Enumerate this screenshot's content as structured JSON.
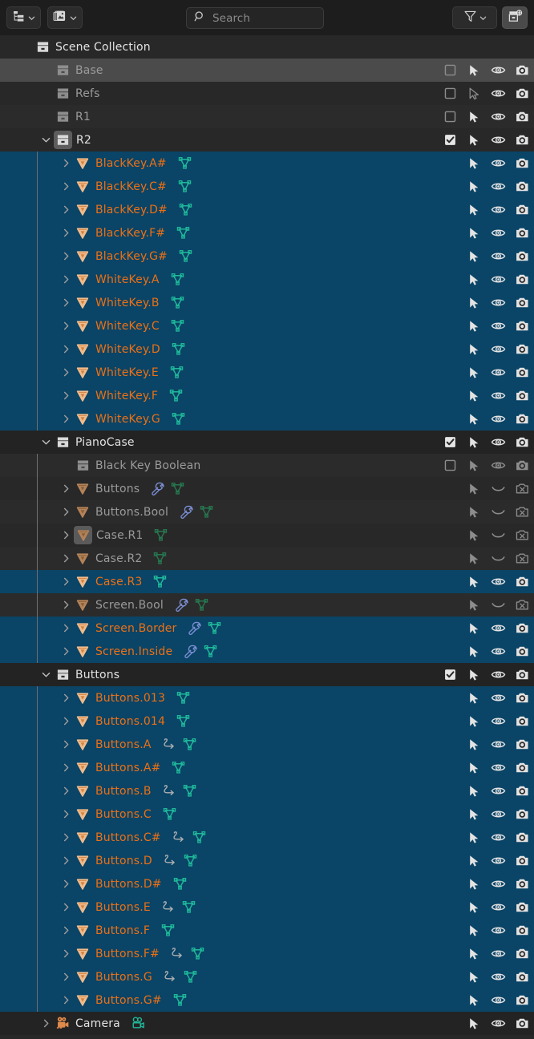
{
  "header": {
    "display_mode_button": "outliner-display-mode",
    "display_mode_icon": "tree-list-icon",
    "filter_id_button": "blend-file-id-icon",
    "search": {
      "placeholder": "Search",
      "value": "",
      "icon": "search-icon"
    },
    "filter": {
      "icon": "filter-funnel-icon",
      "label": ""
    },
    "new_collection": {
      "icon": "new-collection-icon",
      "label": ""
    }
  },
  "colors": {
    "selected_row_bg": "#0a4466",
    "active_row_bg": "#4b4b4b",
    "row_bg_a": "#2b2b2b",
    "row_bg_b": "#282828",
    "header_bg": "#1d1d1d",
    "collection_header_bg": "#232323",
    "selected_text": "#ed7014",
    "normal_text": "#e2e2e2",
    "dim_text": "#9a9a9a",
    "mesh_data_icon": "#1fb89a",
    "mesh_data_icon_dim": "#27764f",
    "modifier_icon": "#7b8fd4",
    "object_icon": "#e08a4b",
    "camera_icon": "#e08a4b"
  },
  "rows": [
    {
      "label": "Scene Collection",
      "type": "scene-collection",
      "depth": 0,
      "state": "plain",
      "text": "white",
      "disclosure": "none",
      "icon": "collection-icon",
      "icon_variant": "bright",
      "subicons": [],
      "right": []
    },
    {
      "label": "Base",
      "type": "collection",
      "depth": 1,
      "state": "active",
      "text": "grey",
      "disclosure": "none",
      "icon": "collection-icon",
      "icon_variant": "dim",
      "subicons": [],
      "right": [
        "checkbox-off",
        "cursor-select-on",
        "eye-open",
        "camera-on"
      ]
    },
    {
      "label": "Refs",
      "type": "collection",
      "depth": 1,
      "state": "plain",
      "text": "grey",
      "disclosure": "none",
      "icon": "collection-icon",
      "icon_variant": "dim",
      "subicons": [],
      "right": [
        "checkbox-off",
        "cursor-select-off",
        "eye-open",
        "camera-on"
      ]
    },
    {
      "label": "R1",
      "type": "collection",
      "depth": 1,
      "state": "zebra",
      "text": "grey",
      "disclosure": "none",
      "icon": "collection-icon",
      "icon_variant": "dim",
      "subicons": [],
      "right": [
        "checkbox-off",
        "cursor-select-on",
        "eye-open",
        "camera-on"
      ]
    },
    {
      "label": "R2",
      "type": "collection",
      "depth": 1,
      "state": "plain",
      "text": "white",
      "disclosure": "down",
      "icon": "collection-icon",
      "icon_variant": "boxed",
      "subicons": [],
      "right": [
        "checkbox-on",
        "cursor-select-on",
        "eye-open",
        "camera-on"
      ]
    },
    {
      "label": "BlackKey.A#",
      "type": "mesh-object",
      "depth": 2,
      "state": "sel",
      "text": "orange",
      "disclosure": "right",
      "icon": "mesh-object-icon",
      "icon_variant": "bright",
      "subicons": [
        "mesh-data"
      ],
      "right": [
        "cursor-select-on",
        "eye-open",
        "camera-on"
      ]
    },
    {
      "label": "BlackKey.C#",
      "type": "mesh-object",
      "depth": 2,
      "state": "sel",
      "text": "orange",
      "disclosure": "right",
      "icon": "mesh-object-icon",
      "icon_variant": "bright",
      "subicons": [
        "mesh-data"
      ],
      "right": [
        "cursor-select-on",
        "eye-open",
        "camera-on"
      ]
    },
    {
      "label": "BlackKey.D#",
      "type": "mesh-object",
      "depth": 2,
      "state": "sel",
      "text": "orange",
      "disclosure": "right",
      "icon": "mesh-object-icon",
      "icon_variant": "bright",
      "subicons": [
        "mesh-data"
      ],
      "right": [
        "cursor-select-on",
        "eye-open",
        "camera-on"
      ]
    },
    {
      "label": "BlackKey.F#",
      "type": "mesh-object",
      "depth": 2,
      "state": "sel",
      "text": "orange",
      "disclosure": "right",
      "icon": "mesh-object-icon",
      "icon_variant": "bright",
      "subicons": [
        "mesh-data"
      ],
      "right": [
        "cursor-select-on",
        "eye-open",
        "camera-on"
      ]
    },
    {
      "label": "BlackKey.G#",
      "type": "mesh-object",
      "depth": 2,
      "state": "sel",
      "text": "orange",
      "disclosure": "right",
      "icon": "mesh-object-icon",
      "icon_variant": "bright",
      "subicons": [
        "mesh-data"
      ],
      "right": [
        "cursor-select-on",
        "eye-open",
        "camera-on"
      ]
    },
    {
      "label": "WhiteKey.A",
      "type": "mesh-object",
      "depth": 2,
      "state": "sel",
      "text": "orange",
      "disclosure": "right",
      "icon": "mesh-object-icon",
      "icon_variant": "bright",
      "subicons": [
        "mesh-data"
      ],
      "right": [
        "cursor-select-on",
        "eye-open",
        "camera-on"
      ]
    },
    {
      "label": "WhiteKey.B",
      "type": "mesh-object",
      "depth": 2,
      "state": "sel",
      "text": "orange",
      "disclosure": "right",
      "icon": "mesh-object-icon",
      "icon_variant": "bright",
      "subicons": [
        "mesh-data"
      ],
      "right": [
        "cursor-select-on",
        "eye-open",
        "camera-on"
      ]
    },
    {
      "label": "WhiteKey.C",
      "type": "mesh-object",
      "depth": 2,
      "state": "sel",
      "text": "orange",
      "disclosure": "right",
      "icon": "mesh-object-icon",
      "icon_variant": "bright",
      "subicons": [
        "mesh-data"
      ],
      "right": [
        "cursor-select-on",
        "eye-open",
        "camera-on"
      ]
    },
    {
      "label": "WhiteKey.D",
      "type": "mesh-object",
      "depth": 2,
      "state": "sel",
      "text": "orange",
      "disclosure": "right",
      "icon": "mesh-object-icon",
      "icon_variant": "bright",
      "subicons": [
        "mesh-data"
      ],
      "right": [
        "cursor-select-on",
        "eye-open",
        "camera-on"
      ]
    },
    {
      "label": "WhiteKey.E",
      "type": "mesh-object",
      "depth": 2,
      "state": "sel",
      "text": "orange",
      "disclosure": "right",
      "icon": "mesh-object-icon",
      "icon_variant": "bright",
      "subicons": [
        "mesh-data"
      ],
      "right": [
        "cursor-select-on",
        "eye-open",
        "camera-on"
      ]
    },
    {
      "label": "WhiteKey.F",
      "type": "mesh-object",
      "depth": 2,
      "state": "sel",
      "text": "orange",
      "disclosure": "right",
      "icon": "mesh-object-icon",
      "icon_variant": "bright",
      "subicons": [
        "mesh-data"
      ],
      "right": [
        "cursor-select-on",
        "eye-open",
        "camera-on"
      ]
    },
    {
      "label": "WhiteKey.G",
      "type": "mesh-object",
      "depth": 2,
      "state": "sel",
      "text": "orange",
      "disclosure": "right",
      "icon": "mesh-object-icon",
      "icon_variant": "bright",
      "subicons": [
        "mesh-data"
      ],
      "right": [
        "cursor-select-on",
        "eye-open",
        "camera-on"
      ]
    },
    {
      "label": "PianoCase",
      "type": "collection",
      "depth": 1,
      "state": "hdrcol",
      "text": "white",
      "disclosure": "down",
      "icon": "collection-icon",
      "icon_variant": "bright",
      "subicons": [],
      "right": [
        "checkbox-on",
        "cursor-select-on",
        "eye-open",
        "camera-on"
      ]
    },
    {
      "label": "Black Key Boolean",
      "type": "collection",
      "depth": 2,
      "state": "zebra",
      "text": "grey",
      "disclosure": "none",
      "icon": "collection-icon",
      "icon_variant": "dim",
      "subicons": [],
      "right": [
        "checkbox-off",
        "cursor-select-dim",
        "eye-open-dim",
        "camera-dim"
      ]
    },
    {
      "label": "Buttons",
      "type": "mesh-object",
      "depth": 2,
      "state": "plain",
      "text": "grey",
      "disclosure": "right",
      "icon": "mesh-object-icon",
      "icon_variant": "dim",
      "subicons": [
        "modifier",
        "mesh-data-dim"
      ],
      "right": [
        "cursor-select-dim",
        "eye-closed",
        "camera-off"
      ]
    },
    {
      "label": "Buttons.Bool",
      "type": "mesh-object",
      "depth": 2,
      "state": "zebra",
      "text": "grey",
      "disclosure": "right",
      "icon": "mesh-object-icon",
      "icon_variant": "dim",
      "subicons": [
        "modifier",
        "mesh-data-dim"
      ],
      "right": [
        "cursor-select-dim",
        "eye-closed",
        "camera-off"
      ]
    },
    {
      "label": "Case.R1",
      "type": "mesh-object",
      "depth": 2,
      "state": "plain",
      "text": "grey",
      "disclosure": "right",
      "icon": "mesh-object-icon",
      "icon_variant": "boxed-dim",
      "subicons": [
        "mesh-data-dim"
      ],
      "right": [
        "cursor-select-dim",
        "eye-closed",
        "camera-off"
      ]
    },
    {
      "label": "Case.R2",
      "type": "mesh-object",
      "depth": 2,
      "state": "zebra",
      "text": "grey",
      "disclosure": "right",
      "icon": "mesh-object-icon",
      "icon_variant": "dim",
      "subicons": [
        "mesh-data-dim"
      ],
      "right": [
        "cursor-select-dim",
        "eye-closed",
        "camera-off"
      ]
    },
    {
      "label": "Case.R3",
      "type": "mesh-object",
      "depth": 2,
      "state": "sel",
      "text": "orange",
      "disclosure": "right",
      "icon": "mesh-object-icon",
      "icon_variant": "bright",
      "subicons": [
        "mesh-data"
      ],
      "right": [
        "cursor-select-on",
        "eye-open",
        "camera-on"
      ]
    },
    {
      "label": "Screen.Bool",
      "type": "mesh-object",
      "depth": 2,
      "state": "zebra",
      "text": "grey",
      "disclosure": "right",
      "icon": "mesh-object-icon",
      "icon_variant": "dim",
      "subicons": [
        "modifier",
        "mesh-data-dim"
      ],
      "right": [
        "cursor-select-dim",
        "eye-closed",
        "camera-off"
      ]
    },
    {
      "label": "Screen.Border",
      "type": "mesh-object",
      "depth": 2,
      "state": "sel",
      "text": "orange",
      "disclosure": "right",
      "icon": "mesh-object-icon",
      "icon_variant": "bright",
      "subicons": [
        "modifier",
        "mesh-data"
      ],
      "right": [
        "cursor-select-on",
        "eye-open",
        "camera-on"
      ]
    },
    {
      "label": "Screen.Inside",
      "type": "mesh-object",
      "depth": 2,
      "state": "sel",
      "text": "orange",
      "disclosure": "right",
      "icon": "mesh-object-icon",
      "icon_variant": "bright",
      "subicons": [
        "modifier",
        "mesh-data"
      ],
      "right": [
        "cursor-select-on",
        "eye-open",
        "camera-on"
      ]
    },
    {
      "label": "Buttons",
      "type": "collection",
      "depth": 1,
      "state": "hdrcol",
      "text": "white",
      "disclosure": "down",
      "icon": "collection-icon",
      "icon_variant": "bright",
      "subicons": [],
      "right": [
        "checkbox-on",
        "cursor-select-on",
        "eye-open",
        "camera-on"
      ]
    },
    {
      "label": "Buttons.013",
      "type": "mesh-object",
      "depth": 2,
      "state": "sel",
      "text": "orange",
      "disclosure": "right",
      "icon": "mesh-object-icon",
      "icon_variant": "bright",
      "subicons": [
        "mesh-data"
      ],
      "right": [
        "cursor-select-on",
        "eye-open",
        "camera-on"
      ]
    },
    {
      "label": "Buttons.014",
      "type": "mesh-object",
      "depth": 2,
      "state": "sel",
      "text": "orange",
      "disclosure": "right",
      "icon": "mesh-object-icon",
      "icon_variant": "bright",
      "subicons": [
        "mesh-data"
      ],
      "right": [
        "cursor-select-on",
        "eye-open",
        "camera-on"
      ]
    },
    {
      "label": "Buttons.A",
      "type": "mesh-object",
      "depth": 2,
      "state": "sel",
      "text": "orange",
      "disclosure": "right",
      "icon": "mesh-object-icon",
      "icon_variant": "bright",
      "subicons": [
        "animation",
        "mesh-data"
      ],
      "right": [
        "cursor-select-on",
        "eye-open",
        "camera-on"
      ]
    },
    {
      "label": "Buttons.A#",
      "type": "mesh-object",
      "depth": 2,
      "state": "sel",
      "text": "orange",
      "disclosure": "right",
      "icon": "mesh-object-icon",
      "icon_variant": "bright",
      "subicons": [
        "mesh-data"
      ],
      "right": [
        "cursor-select-on",
        "eye-open",
        "camera-on"
      ]
    },
    {
      "label": "Buttons.B",
      "type": "mesh-object",
      "depth": 2,
      "state": "sel",
      "text": "orange",
      "disclosure": "right",
      "icon": "mesh-object-icon",
      "icon_variant": "bright",
      "subicons": [
        "animation",
        "mesh-data"
      ],
      "right": [
        "cursor-select-on",
        "eye-open",
        "camera-on"
      ]
    },
    {
      "label": "Buttons.C",
      "type": "mesh-object",
      "depth": 2,
      "state": "sel",
      "text": "orange",
      "disclosure": "right",
      "icon": "mesh-object-icon",
      "icon_variant": "bright",
      "subicons": [
        "mesh-data"
      ],
      "right": [
        "cursor-select-on",
        "eye-open",
        "camera-on"
      ]
    },
    {
      "label": "Buttons.C#",
      "type": "mesh-object",
      "depth": 2,
      "state": "sel",
      "text": "orange",
      "disclosure": "right",
      "icon": "mesh-object-icon",
      "icon_variant": "bright",
      "subicons": [
        "animation",
        "mesh-data"
      ],
      "right": [
        "cursor-select-on",
        "eye-open",
        "camera-on"
      ]
    },
    {
      "label": "Buttons.D",
      "type": "mesh-object",
      "depth": 2,
      "state": "sel",
      "text": "orange",
      "disclosure": "right",
      "icon": "mesh-object-icon",
      "icon_variant": "bright",
      "subicons": [
        "animation",
        "mesh-data"
      ],
      "right": [
        "cursor-select-on",
        "eye-open",
        "camera-on"
      ]
    },
    {
      "label": "Buttons.D#",
      "type": "mesh-object",
      "depth": 2,
      "state": "sel",
      "text": "orange",
      "disclosure": "right",
      "icon": "mesh-object-icon",
      "icon_variant": "bright",
      "subicons": [
        "mesh-data"
      ],
      "right": [
        "cursor-select-on",
        "eye-open",
        "camera-on"
      ]
    },
    {
      "label": "Buttons.E",
      "type": "mesh-object",
      "depth": 2,
      "state": "sel",
      "text": "orange",
      "disclosure": "right",
      "icon": "mesh-object-icon",
      "icon_variant": "bright",
      "subicons": [
        "animation",
        "mesh-data"
      ],
      "right": [
        "cursor-select-on",
        "eye-open",
        "camera-on"
      ]
    },
    {
      "label": "Buttons.F",
      "type": "mesh-object",
      "depth": 2,
      "state": "sel",
      "text": "orange",
      "disclosure": "right",
      "icon": "mesh-object-icon",
      "icon_variant": "bright",
      "subicons": [
        "mesh-data"
      ],
      "right": [
        "cursor-select-on",
        "eye-open",
        "camera-on"
      ]
    },
    {
      "label": "Buttons.F#",
      "type": "mesh-object",
      "depth": 2,
      "state": "sel",
      "text": "orange",
      "disclosure": "right",
      "icon": "mesh-object-icon",
      "icon_variant": "bright",
      "subicons": [
        "animation",
        "mesh-data"
      ],
      "right": [
        "cursor-select-on",
        "eye-open",
        "camera-on"
      ]
    },
    {
      "label": "Buttons.G",
      "type": "mesh-object",
      "depth": 2,
      "state": "sel",
      "text": "orange",
      "disclosure": "right",
      "icon": "mesh-object-icon",
      "icon_variant": "bright",
      "subicons": [
        "animation",
        "mesh-data"
      ],
      "right": [
        "cursor-select-on",
        "eye-open",
        "camera-on"
      ]
    },
    {
      "label": "Buttons.G#",
      "type": "mesh-object",
      "depth": 2,
      "state": "sel",
      "text": "orange",
      "disclosure": "right",
      "icon": "mesh-object-icon",
      "icon_variant": "bright",
      "subicons": [
        "mesh-data"
      ],
      "right": [
        "cursor-select-on",
        "eye-open",
        "camera-on"
      ]
    },
    {
      "label": "Camera",
      "type": "camera-object",
      "depth": 1,
      "state": "hdrcol",
      "text": "white",
      "disclosure": "right",
      "icon": "camera-object-icon",
      "icon_variant": "bright",
      "subicons": [
        "camera-data"
      ],
      "right": [
        "cursor-select-on",
        "eye-open",
        "camera-on"
      ]
    }
  ]
}
